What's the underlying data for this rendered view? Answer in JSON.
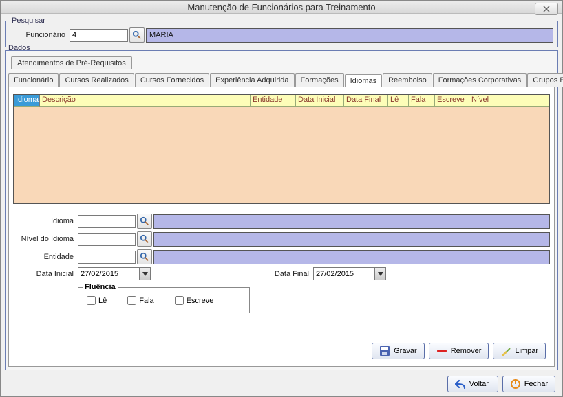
{
  "window": {
    "title": "Manutenção de Funcionários para Treinamento"
  },
  "pesquisar": {
    "legend": "Pesquisar",
    "funcionario_label": "Funcionário",
    "funcionario_value": "4",
    "funcionario_name": "MARIA"
  },
  "dados": {
    "legend": "Dados",
    "tab_upper": "Atendimentos de Pré-Requisitos",
    "tabs": [
      "Funcionário",
      "Cursos Realizados",
      "Cursos Fornecidos",
      "Experiência Adquirida",
      "Formações",
      "Idiomas",
      "Reembolso",
      "Formações Corporativas",
      "Grupos Especiais"
    ],
    "active_tab": "Idiomas",
    "grid_headers": [
      "Idioma",
      "Descrição",
      "Entidade",
      "Data Inicial",
      "Data Final",
      "Lê",
      "Fala",
      "Escreve",
      "Nível"
    ],
    "form": {
      "idioma_label": "Idioma",
      "idioma_value": "",
      "nivel_label": "Nível do Idioma",
      "nivel_value": "",
      "entidade_label": "Entidade",
      "entidade_value": "",
      "data_inicial_label": "Data Inicial",
      "data_inicial_value": "27/02/2015",
      "data_final_label": "Data Final",
      "data_final_value": "27/02/2015",
      "fluencia_legend": "Fluência",
      "le_label": "Lê",
      "fala_label": "Fala",
      "escreve_label": "Escreve"
    },
    "buttons": {
      "gravar": "Gravar",
      "remover": "Remover",
      "limpar": "Limpar",
      "voltar": "Voltar",
      "fechar": "Fechar"
    }
  }
}
